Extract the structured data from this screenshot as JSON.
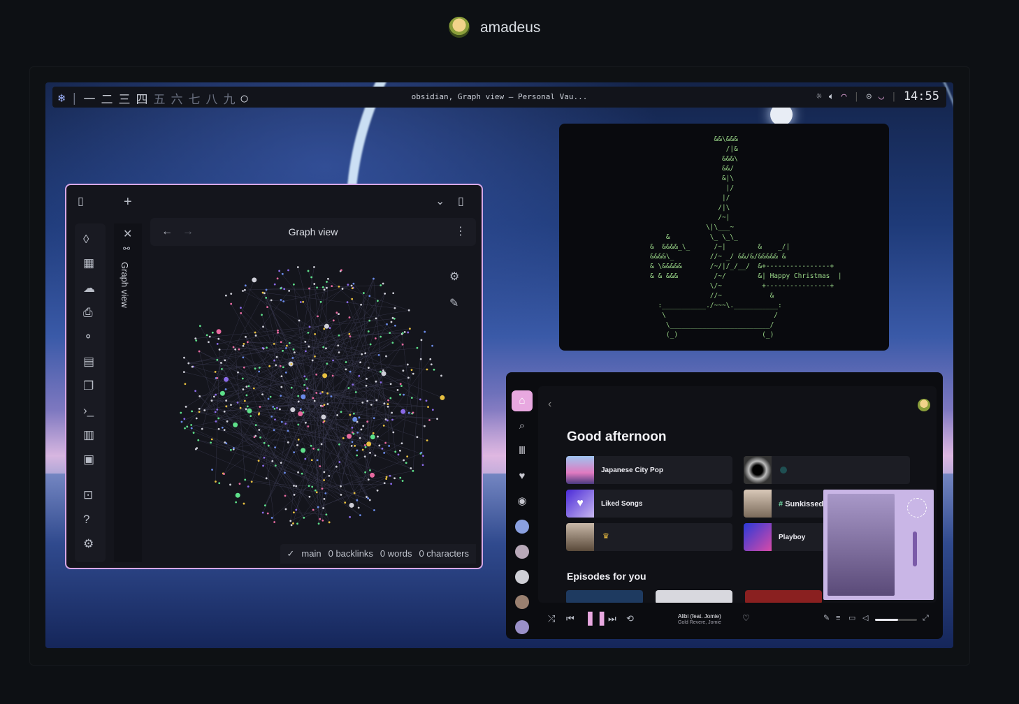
{
  "header": {
    "username": "amadeus"
  },
  "topbar": {
    "distro_icon": "❄",
    "workspaces": [
      "一",
      "二",
      "三",
      "四",
      "五",
      "六",
      "七",
      "八",
      "九"
    ],
    "workspace_extra": "○",
    "window_title": "obsidian, Graph view – Personal Vau...",
    "tray_icons": [
      "brightness-icon",
      "volume-icon",
      "wifi-icon",
      "record-icon",
      "moon-icon"
    ],
    "clock": "14:55"
  },
  "obsidian": {
    "tab_title": "Graph view",
    "sidebar_label": "Graph view",
    "status": {
      "branch": "main",
      "backlinks": "0 backlinks",
      "words": "0 words",
      "characters": "0 characters"
    }
  },
  "terminal": {
    "ascii_art": "                &&\\&&&\n                   /|&\n                  &&&\\\n                  &&/\n                  &|\\\n                   |/\n                  |/\n                 /|\\\n                 /~|\n              \\|\\___~\n    &          \\_ \\_\\_\n&  &&&&_\\_      /~|        &    _/|\n&&&&\\_         //~ _/ &&/&/&&&&& &\n& \\&&&&&       /~/|/_/__/  &+----------------+\n& & &&&         /~/        &| Happy Christmas  |\n               \\/~          +----------------+\n               //~            &\n  :___________./~~~\\.___________:\n   \\                           /\n    \\_________________________/\n    (_)                     (_)"
  },
  "spotify": {
    "greeting": "Good afternoon",
    "cards": [
      "Japanese City Pop",
      "",
      "Liked Songs",
      "Sunkissed",
      "",
      "Playboy"
    ],
    "section_episodes": "Episodes for you",
    "now_playing": {
      "title": "Alibi (feat. Jomie)",
      "artist": "Gold Revere, Jomie",
      "volume": 0.55
    }
  },
  "colors": {
    "accent": "#d8a8e8",
    "spotify_home": "#e8a8e0",
    "term_text": "#9bd889"
  }
}
